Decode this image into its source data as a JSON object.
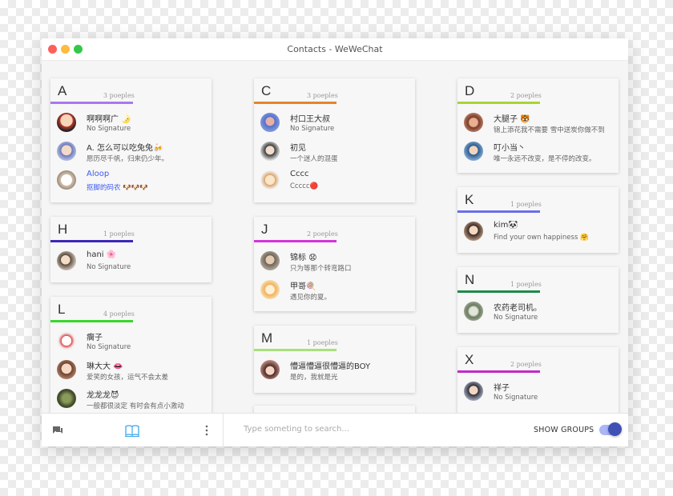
{
  "window": {
    "title": "Contacts - WeWeChat"
  },
  "groups": {
    "a": {
      "letter": "A",
      "count": "3 poeples",
      "color": "#a878f0",
      "contacts": [
        {
          "name": "啊啊啊广 🌛",
          "signature": "No Signature"
        },
        {
          "name": "A. 怎么可以吃兔兔🍻",
          "signature": "愿历尽千帆，归来仍少年。"
        },
        {
          "name": "Aloop",
          "signature": "抠脚的码农 🐶🐶🐶"
        }
      ]
    },
    "c": {
      "letter": "C",
      "count": "3 poeples",
      "color": "#e8832b",
      "contacts": [
        {
          "name": "村口王大叔",
          "signature": "No Signature"
        },
        {
          "name": "初见",
          "signature": "一个迷人的混蛋"
        },
        {
          "name": "Cccc",
          "signature": "Ccccc🔴"
        }
      ]
    },
    "d": {
      "letter": "D",
      "count": "2 poeples",
      "color": "#a9d534",
      "contacts": [
        {
          "name": "大腿子 🐯",
          "signature": "锦上添花我不需要 雪中送炭你做不到"
        },
        {
          "name": "叮小当丶",
          "signature": "唯一永远不改变，是不停的改变。"
        }
      ]
    },
    "h": {
      "letter": "H",
      "count": "1 poeples",
      "color": "#3d28b8",
      "contacts": [
        {
          "name": "hani 🌸",
          "signature": "No Signature"
        }
      ]
    },
    "j": {
      "letter": "J",
      "count": "2 poeples",
      "color": "#d334d8",
      "contacts": [
        {
          "name": "锦标 😧",
          "signature": "只为等那个转弯路口"
        },
        {
          "name": "甲哥🍭",
          "signature": "遇见你的夏。"
        }
      ]
    },
    "k": {
      "letter": "K",
      "count": "1 poeples",
      "color": "#6b6ee8",
      "contacts": [
        {
          "name": "kim🐼",
          "signature": "Find your own happiness 🤗"
        }
      ]
    },
    "l": {
      "letter": "L",
      "count": "4 poeples",
      "color": "#38d62c",
      "contacts": [
        {
          "name": "瘸子",
          "signature": "No Signature"
        },
        {
          "name": "琳大大 👄",
          "signature": "爱笑的女孩，运气不会太差"
        },
        {
          "name": "龙龙龙😈",
          "signature": "一般都很淡定 有时会有点小激动"
        }
      ]
    },
    "m": {
      "letter": "M",
      "count": "1 poeples",
      "color": "#a8e07a",
      "contacts": [
        {
          "name": "懵逼懵逼很懵逼的BOY",
          "signature": "是的，我就是光"
        }
      ]
    },
    "n": {
      "letter": "N",
      "count": "1 poeples",
      "color": "#1e8a4a",
      "contacts": [
        {
          "name": "农药老司机。",
          "signature": "No Signature"
        }
      ]
    },
    "x": {
      "letter": "X",
      "count": "2 poeples",
      "color": "#c229c8",
      "contacts": [
        {
          "name": "祥子",
          "signature": "No Signature"
        }
      ]
    }
  },
  "bottom": {
    "search_placeholder": "Type someting to search...",
    "toggle_label": "SHOW GROUPS",
    "toggle_on": true,
    "icons": [
      "chat-icon",
      "contacts-book-icon",
      "more-vertical-icon"
    ],
    "active_color": "#3da7e8"
  }
}
